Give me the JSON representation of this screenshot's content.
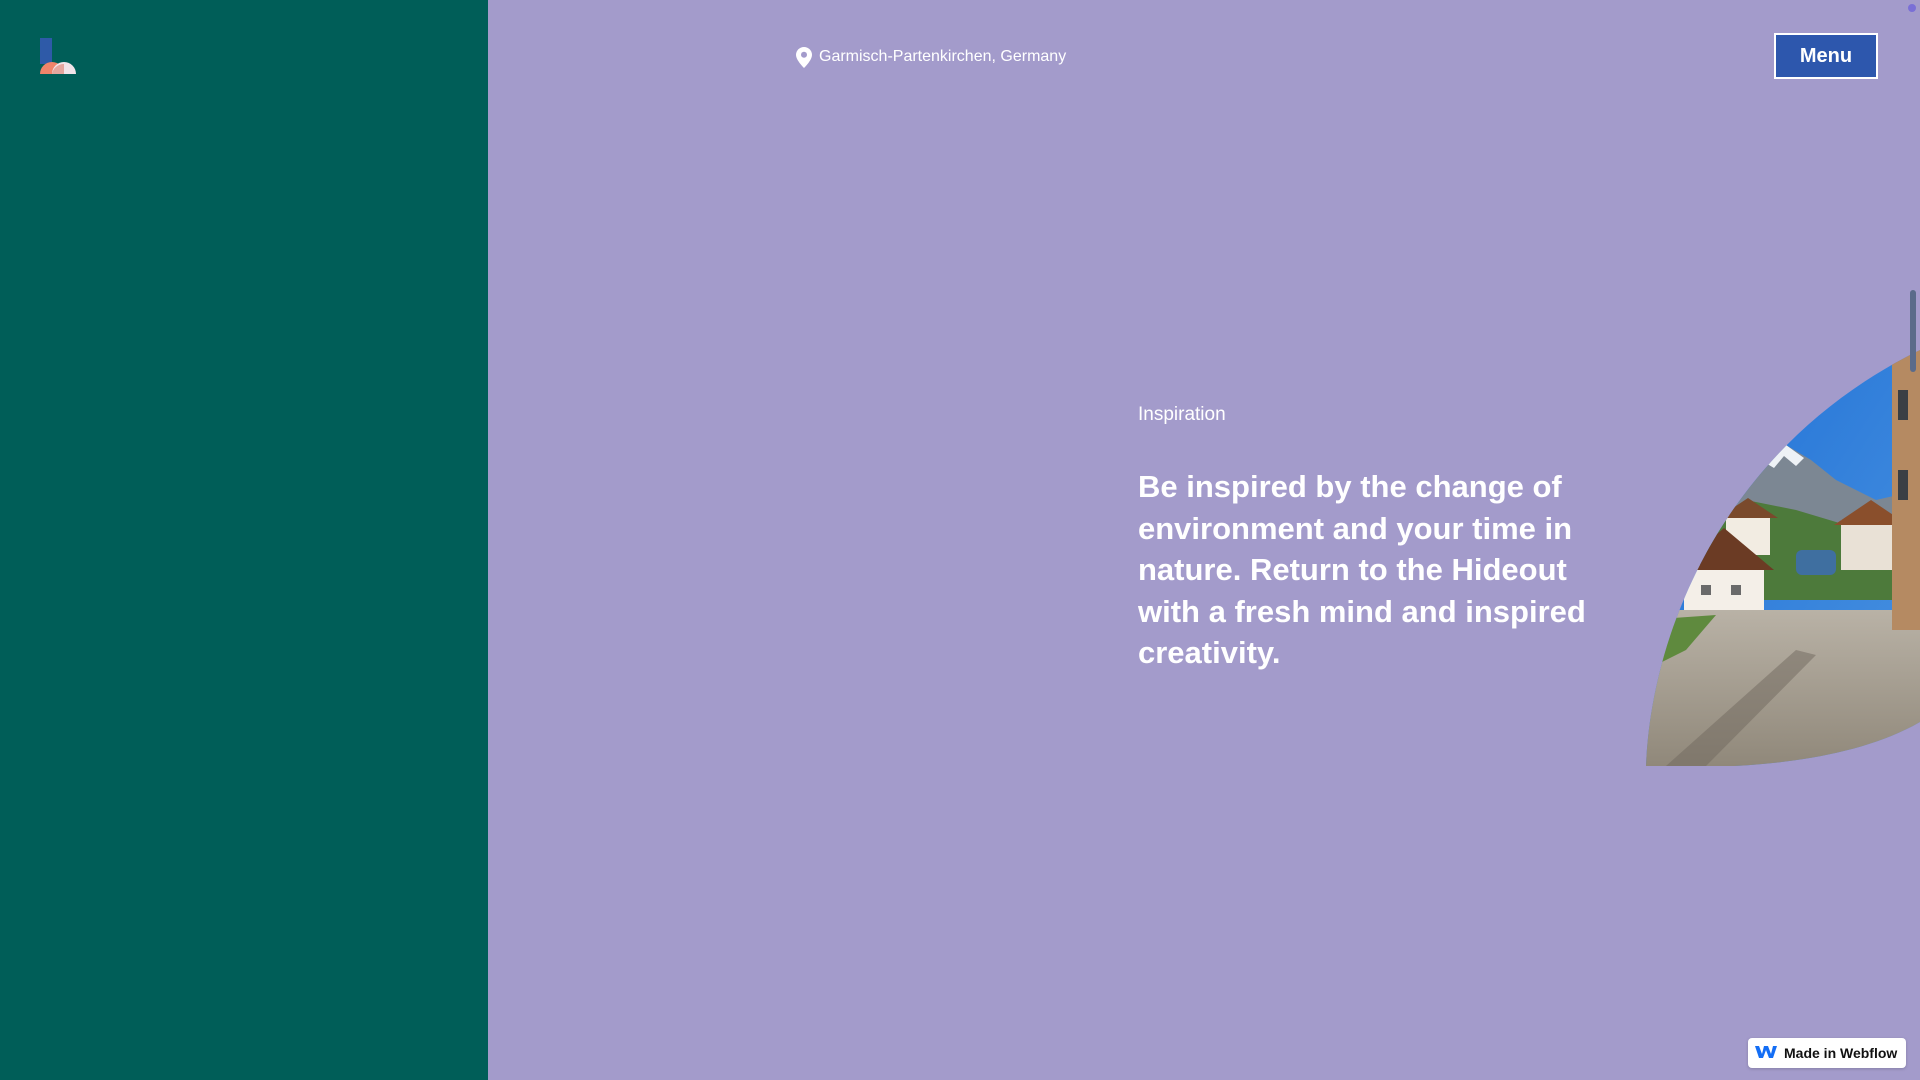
{
  "header": {
    "logo_icon": "hideout-logo-icon",
    "location_icon": "map-pin-icon",
    "location_text": "Garmisch-Partenkirchen, Germany",
    "menu_label": "Menu"
  },
  "main": {
    "eyebrow": "Inspiration",
    "headline": "Be inspired by the change of environment and your time in nature. Return to the Hideout with a fresh mind and inspired creativity."
  },
  "badge": {
    "icon": "webflow-logo-icon",
    "label": "Made in Webflow"
  },
  "colors": {
    "left_panel": "#005e58",
    "background": "#a39bcb",
    "menu_button": "#2d57ad",
    "text": "#ffffff"
  }
}
